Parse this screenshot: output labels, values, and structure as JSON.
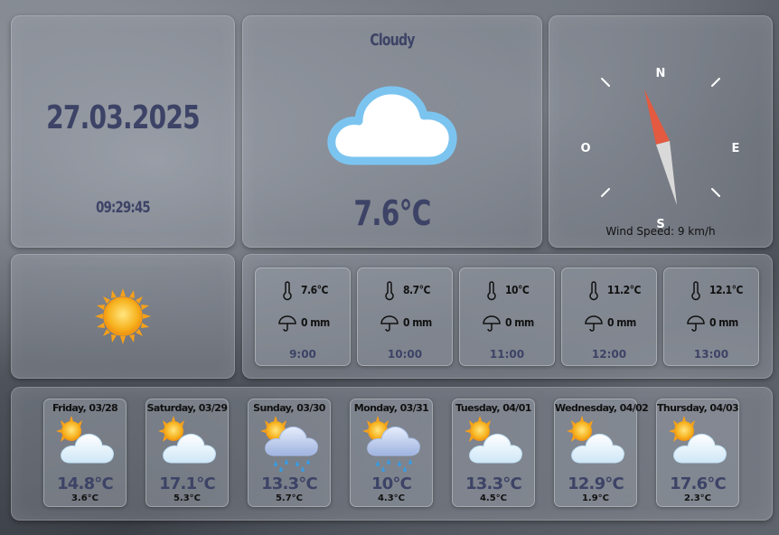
{
  "date": "27.03.2025",
  "time": "09:29:45",
  "current": {
    "condition": "Cloudy",
    "icon": "cloud-icon",
    "temperature": "7.6°C"
  },
  "compass": {
    "north": "N",
    "east": "E",
    "south": "S",
    "west": "O",
    "wind_speed_text": "Wind Speed: 9 km/h"
  },
  "sun_icon": "sun-icon",
  "hourly": [
    {
      "temp": "7.6°C",
      "rain": "0 mm",
      "time": "9:00"
    },
    {
      "temp": "8.7°C",
      "rain": "0 mm",
      "time": "10:00"
    },
    {
      "temp": "10°C",
      "rain": "0 mm",
      "time": "11:00"
    },
    {
      "temp": "11.2°C",
      "rain": "0 mm",
      "time": "12:00"
    },
    {
      "temp": "12.1°C",
      "rain": "0 mm",
      "time": "13:00"
    }
  ],
  "daily": [
    {
      "day": "Friday, 03/28",
      "icon": "partly-cloudy-icon",
      "max": "14.8°C",
      "min": "3.6°C"
    },
    {
      "day": "Saturday, 03/29",
      "icon": "partly-cloudy-icon",
      "max": "17.1°C",
      "min": "5.3°C"
    },
    {
      "day": "Sunday, 03/30",
      "icon": "rain-icon",
      "max": "13.3°C",
      "min": "5.7°C"
    },
    {
      "day": "Monday, 03/31",
      "icon": "rain-icon",
      "max": "10°C",
      "min": "4.3°C"
    },
    {
      "day": "Tuesday, 04/01",
      "icon": "partly-cloudy-icon",
      "max": "13.3°C",
      "min": "4.5°C"
    },
    {
      "day": "Wednesday, 04/02",
      "icon": "partly-cloudy-icon",
      "max": "12.9°C",
      "min": "1.9°C"
    },
    {
      "day": "Thursday, 04/03",
      "icon": "partly-cloudy-icon",
      "max": "17.6°C",
      "min": "2.3°C"
    }
  ],
  "colors": {
    "title_text": "#3d4366",
    "cloud_outline": "#7cc4f0",
    "sun": "#f7a81b",
    "needle_north": "#e35a40",
    "needle_south": "#d9d9d9"
  }
}
